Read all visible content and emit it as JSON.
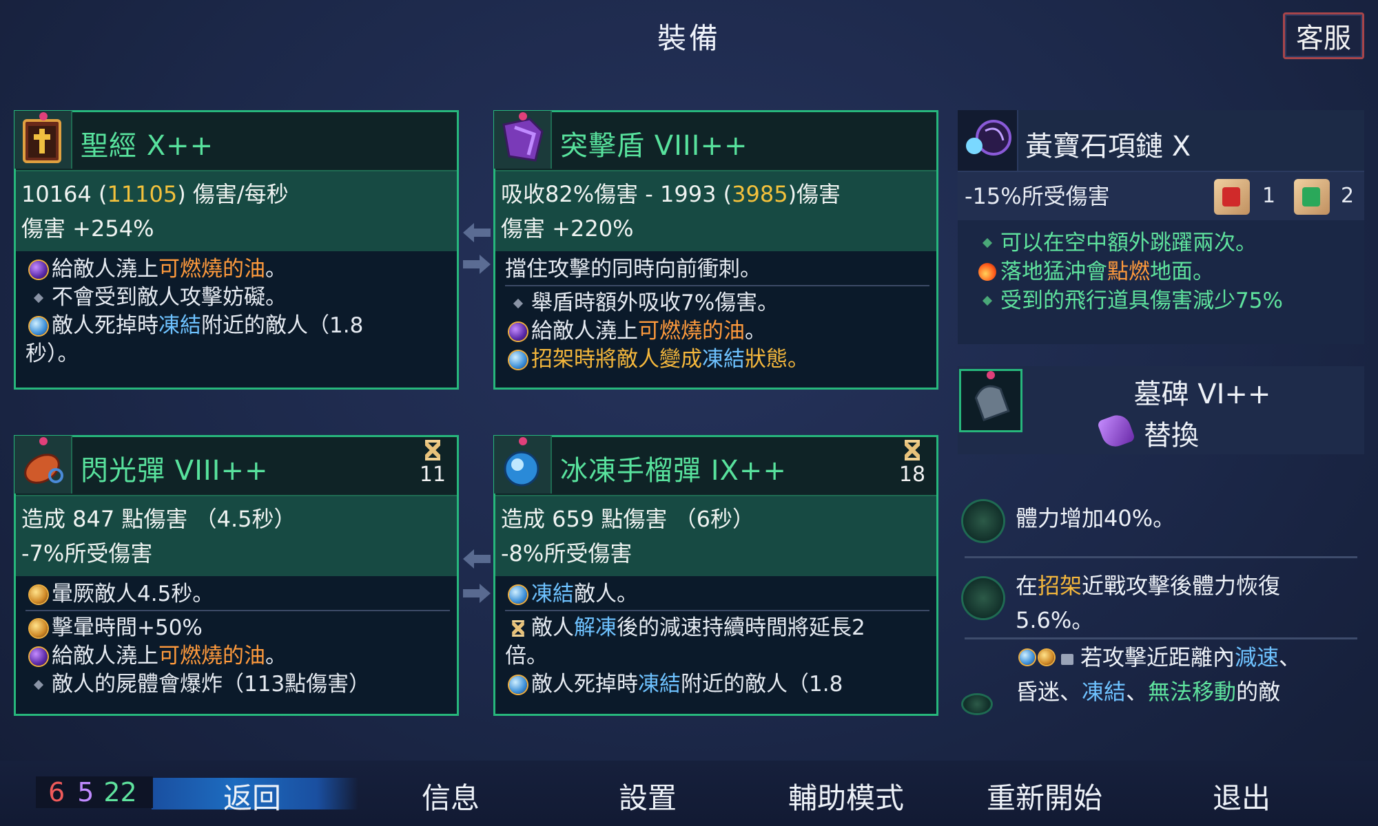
{
  "header": {
    "title": "裝備",
    "support_button": "客服"
  },
  "cards": {
    "bible": {
      "name": "聖經 X++",
      "dps_a": "10164 (",
      "dps_b": "11105",
      "dps_c": ") 傷害/每秒",
      "bonus": "傷害 +254%",
      "e1_a": "給敵人澆上",
      "e1_b": "可燃燒的油",
      "e1_c": "。",
      "e2": "不會受到敵人攻擊妨礙。",
      "e3_a": "敵人死掉時",
      "e3_b": "凍結",
      "e3_c": "附近的敵人（1.8",
      "e3_d": "秒）。"
    },
    "shield": {
      "name": "突擊盾 VIII++",
      "stat_a": "吸收82%傷害 - 1993 (",
      "stat_b": "3985",
      "stat_c": ")傷害",
      "bonus": "傷害 +220%",
      "main": "擋住攻擊的同時向前衝刺。",
      "e1": "舉盾時額外吸收7%傷害。",
      "e2_a": "給敵人澆上",
      "e2_b": "可燃燒的油",
      "e2_c": "。",
      "e3_a": "招架",
      "e3_b": "時將敵人變成",
      "e3_c": "凍結",
      "e3_d": "狀態。"
    },
    "flash": {
      "name": "閃光彈 VIII++",
      "timer": "11",
      "stat": "造成 847 點傷害 （4.5秒）",
      "res": "-7%所受傷害",
      "main": "暈厥敵人4.5秒。",
      "e1": "擊暈時間+50%",
      "e2_a": "給敵人澆上",
      "e2_b": "可燃燒的油",
      "e2_c": "。",
      "e3": "敵人的屍體會爆炸（113點傷害）"
    },
    "ice": {
      "name": "冰凍手榴彈 IX++",
      "timer": "18",
      "stat": "造成 659 點傷害 （6秒）",
      "res": "-8%所受傷害",
      "main_a": "凍結",
      "main_b": "敵人。",
      "e1_a": "敵人",
      "e1_b": "解凍",
      "e1_c": "後的減速持續時間將延長2",
      "e1_d": "倍。",
      "e2_a": "敵人死掉時",
      "e2_b": "凍結",
      "e2_c": "附近的敵人（1.8"
    }
  },
  "amulet": {
    "name": "黃寶石項鏈 X",
    "res": "-15%所受傷害",
    "scroll1": "1",
    "scroll2": "2",
    "e1": "可以在空中額外跳躍兩次。",
    "e2_a": "落地猛沖會",
    "e2_b": "點燃",
    "e2_c": "地面。",
    "e3": "受到的飛行道具傷害減少75%"
  },
  "grave": {
    "name": "墓碑 VI++",
    "swap": "替換"
  },
  "mutations": {
    "m1": "體力增加40%。",
    "m2_a": "在",
    "m2_b": "招架",
    "m2_c": "近戰攻擊後體力恢復",
    "m2_d": "5.6%。",
    "m3_a": "若攻擊近距離內",
    "m3_b": "減速",
    "m3_c": "、",
    "m3_d": "昏迷、",
    "m3_e": "凍結",
    "m3_f": "、",
    "m3_g": "無法移動",
    "m3_h": "的敵"
  },
  "bottom": {
    "counter_red": "6",
    "counter_purple": "5",
    "counter_green": "22",
    "menu": [
      "返回",
      "信息",
      "設置",
      "輔助模式",
      "重新開始",
      "退出"
    ]
  },
  "colors": {
    "card_border": "#27b77c",
    "name_green": "#58e29d",
    "highlight_orange": "#ff9a3c",
    "highlight_cyan": "#6ec2ff",
    "highlight_gold": "#f4c23c",
    "back_highlight": "#1d6cc0"
  }
}
